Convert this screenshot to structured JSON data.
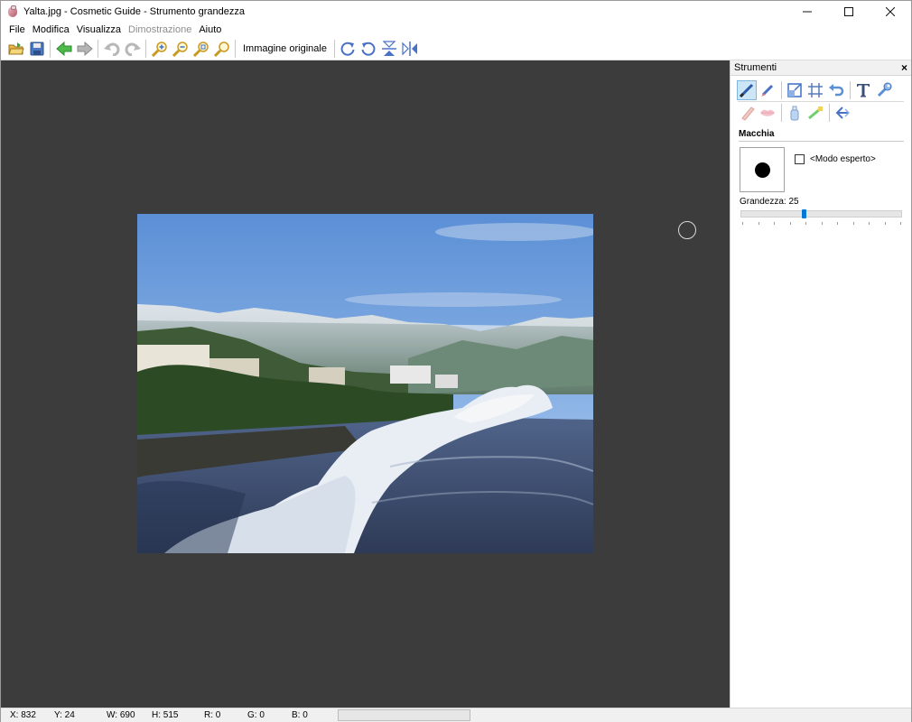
{
  "window": {
    "title": "Yalta.jpg - Cosmetic Guide - Strumento grandezza",
    "controls": {
      "minimize": "—",
      "maximize": "☐",
      "close": "✕"
    }
  },
  "menu": [
    {
      "label": "File",
      "enabled": true
    },
    {
      "label": "Modifica",
      "enabled": true
    },
    {
      "label": "Visualizza",
      "enabled": true
    },
    {
      "label": "Dimostrazione",
      "enabled": false
    },
    {
      "label": "Aiuto",
      "enabled": true
    }
  ],
  "toolbar": {
    "icons": [
      "open-folder-icon",
      "save-icon",
      "back-arrow-icon",
      "forward-arrow-icon",
      "undo-icon",
      "redo-icon",
      "zoom-in-icon",
      "zoom-out-icon",
      "zoom-fit-icon",
      "zoom-actual-icon",
      "rotate-right-icon",
      "rotate-left-icon",
      "flip-vertical-icon",
      "flip-horizontal-icon"
    ],
    "original_image_label": "Immagine originale"
  },
  "tools_panel": {
    "title": "Strumenti",
    "close_label": "×",
    "row1_icons": [
      "brush-tool-icon",
      "smudge-tool-icon",
      "resize-tool-icon",
      "crop-tool-icon",
      "undo-tool-icon",
      "text-tool-icon",
      "wrench-tool-icon"
    ],
    "row2_icons": [
      "eraser-tool-icon",
      "lips-tool-icon",
      "bottle-tool-icon",
      "toothbrush-tool-icon",
      "arrow-back-tool-icon"
    ],
    "section_title": "Macchia",
    "expert_mode_label": "<Modo esperto>",
    "expert_mode_checked": false,
    "size_label": "Grandezza: 25",
    "size_value": 25,
    "size_min": 0,
    "size_max": 100
  },
  "status": {
    "x": "X: 832",
    "y": "Y: 24",
    "w": "W: 690",
    "h": "H: 515",
    "r": "R: 0",
    "g": "G: 0",
    "b": "B: 0"
  },
  "colors": {
    "canvas_bg": "#3c3c3c",
    "accent": "#0078d7"
  }
}
